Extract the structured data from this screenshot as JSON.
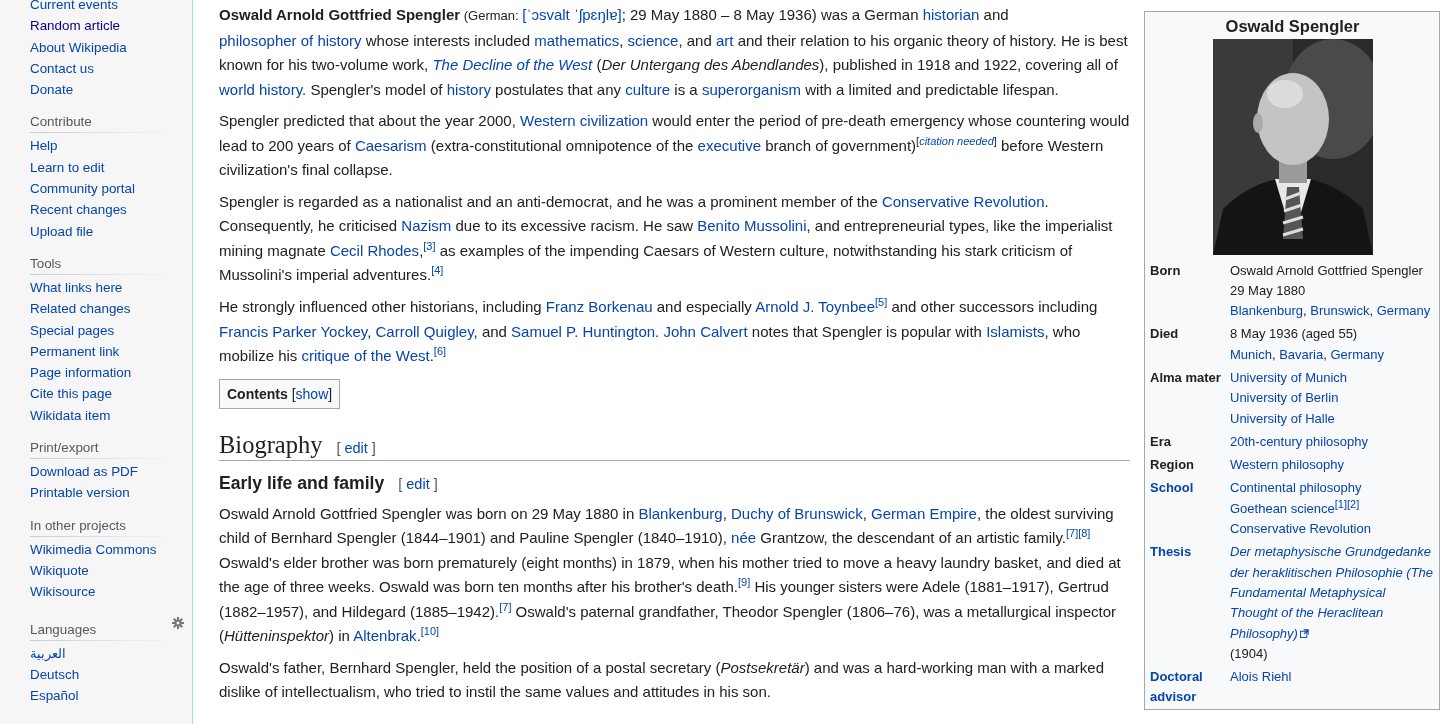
{
  "sidebar": {
    "sections": [
      {
        "kind": "navigation",
        "items": [
          {
            "label": "Current events",
            "visited": false
          },
          {
            "label": "Random article",
            "visited": true
          },
          {
            "label": "About Wikipedia",
            "visited": false
          },
          {
            "label": "Contact us",
            "visited": false
          },
          {
            "label": "Donate",
            "visited": false
          }
        ]
      },
      {
        "kind": "portal",
        "heading": "Contribute",
        "items": [
          {
            "label": "Help",
            "visited": false
          },
          {
            "label": "Learn to edit",
            "visited": false
          },
          {
            "label": "Community portal",
            "visited": false
          },
          {
            "label": "Recent changes",
            "visited": false
          },
          {
            "label": "Upload file",
            "visited": false
          }
        ]
      },
      {
        "kind": "portal",
        "heading": "Tools",
        "items": [
          {
            "label": "What links here",
            "visited": false
          },
          {
            "label": "Related changes",
            "visited": false
          },
          {
            "label": "Special pages",
            "visited": false
          },
          {
            "label": "Permanent link",
            "visited": false
          },
          {
            "label": "Page information",
            "visited": false
          },
          {
            "label": "Cite this page",
            "visited": false
          },
          {
            "label": "Wikidata item",
            "visited": false
          }
        ]
      },
      {
        "kind": "portal",
        "heading": "Print/export",
        "items": [
          {
            "label": "Download as PDF",
            "visited": false
          },
          {
            "label": "Printable version",
            "visited": false
          }
        ]
      },
      {
        "kind": "portal",
        "heading": "In other projects",
        "items": [
          {
            "label": "Wikimedia Commons",
            "visited": false
          },
          {
            "label": "Wikiquote",
            "visited": false
          },
          {
            "label": "Wikisource",
            "visited": false
          }
        ]
      },
      {
        "kind": "languages",
        "heading": "Languages",
        "items": [
          {
            "label": "العربية",
            "visited": false
          },
          {
            "label": "Deutsch",
            "visited": false
          },
          {
            "label": "Español",
            "visited": false
          }
        ]
      }
    ]
  },
  "article": {
    "blocks": [
      {
        "kind": "paragraph",
        "runs": [
          {
            "kind": "bold",
            "text": "Oswald Arnold Gottfried Spengler"
          },
          {
            "kind": "small",
            "text": " (German: "
          },
          {
            "kind": "link",
            "text": "[ˈɔsvalt ˈʃpɛŋlɐ]"
          },
          "; 29 May 1880 – 8 May 1936) was a German ",
          {
            "kind": "link",
            "text": "historian"
          },
          " and ",
          {
            "kind": "link",
            "text": "philosopher of history"
          },
          " whose interests included ",
          {
            "kind": "link",
            "text": "mathematics"
          },
          ", ",
          {
            "kind": "link",
            "text": "science"
          },
          ", and ",
          {
            "kind": "link",
            "text": "art"
          },
          " and their relation to his organic theory of history. He is best known for his two-volume work, ",
          {
            "kind": "link_italic",
            "text": "The Decline of the West"
          },
          " (",
          {
            "kind": "italic",
            "text": "Der Untergang des Abendlandes"
          },
          "), published in 1918 and 1922, covering all of ",
          {
            "kind": "link",
            "text": "world history"
          },
          ". Spengler's model of ",
          {
            "kind": "link",
            "text": "history"
          },
          " postulates that any ",
          {
            "kind": "link",
            "text": "culture"
          },
          " is a ",
          {
            "kind": "link",
            "text": "superorganism"
          },
          " with a limited and predictable lifespan."
        ]
      },
      {
        "kind": "paragraph",
        "runs": [
          "Spengler predicted that about the year 2000, ",
          {
            "kind": "link",
            "text": "Western civilization"
          },
          " would enter the period of pre-death emergency whose countering would lead to 200 years of ",
          {
            "kind": "link",
            "text": "Caesarism"
          },
          " (extra-constitutional omnipotence of the ",
          {
            "kind": "link",
            "text": "executive"
          },
          " branch of government)",
          {
            "kind": "sup",
            "text": "["
          },
          {
            "kind": "sup_link_italic",
            "text": "citation needed"
          },
          {
            "kind": "sup",
            "text": "]"
          },
          " before Western civilization's final collapse."
        ]
      },
      {
        "kind": "paragraph",
        "runs": [
          "Spengler is regarded as a nationalist and an anti-democrat, and he was a prominent member of the ",
          {
            "kind": "link",
            "text": "Conservative Revolution"
          },
          ". Consequently, he criticised ",
          {
            "kind": "link",
            "text": "Nazism"
          },
          " due to its excessive racism. He saw ",
          {
            "kind": "link",
            "text": "Benito Mussolini"
          },
          ", and entrepreneurial types, like the imperialist mining magnate ",
          {
            "kind": "link",
            "text": "Cecil Rhodes"
          },
          ",",
          {
            "kind": "ref",
            "text": "[3]"
          },
          " as examples of the impending Caesars of Western culture, notwithstanding his stark criticism of Mussolini's imperial adventures.",
          {
            "kind": "ref",
            "text": "[4]"
          }
        ]
      },
      {
        "kind": "paragraph",
        "runs": [
          "He strongly influenced other historians, including ",
          {
            "kind": "link",
            "text": "Franz Borkenau"
          },
          " and especially ",
          {
            "kind": "link",
            "text": "Arnold J. Toynbee"
          },
          {
            "kind": "ref",
            "text": "[5]"
          },
          " and other successors including ",
          {
            "kind": "link",
            "text": "Francis Parker Yockey"
          },
          ", ",
          {
            "kind": "link",
            "text": "Carroll Quigley"
          },
          ", and ",
          {
            "kind": "link",
            "text": "Samuel P. Huntington"
          },
          ". ",
          {
            "kind": "link",
            "text": "John Calvert"
          },
          " notes that Spengler is popular with ",
          {
            "kind": "link",
            "text": "Islamists"
          },
          ", who mobilize his ",
          {
            "kind": "link",
            "text": "critique of the West"
          },
          ".",
          {
            "kind": "ref",
            "text": "[6]"
          }
        ]
      },
      {
        "kind": "toc",
        "title": "Contents",
        "open_bracket": "[",
        "toggle": "show",
        "close_bracket": "]"
      },
      {
        "kind": "heading2",
        "title": "Biography",
        "open_bracket": "[",
        "edit": "edit",
        "close_bracket": "]"
      },
      {
        "kind": "heading3",
        "title": "Early life and family",
        "open_bracket": "[",
        "edit": "edit",
        "close_bracket": "]"
      },
      {
        "kind": "paragraph",
        "runs": [
          "Oswald Arnold Gottfried Spengler was born on 29 May 1880 in ",
          {
            "kind": "link",
            "text": "Blankenburg"
          },
          ", ",
          {
            "kind": "link",
            "text": "Duchy of Brunswick"
          },
          ", ",
          {
            "kind": "link",
            "text": "German Empire"
          },
          ", the oldest surviving child of Bernhard Spengler (1844–1901) and Pauline Spengler (1840–1910), ",
          {
            "kind": "link",
            "text": "née"
          },
          " Grantzow, the descendant of an artistic family.",
          {
            "kind": "ref",
            "text": "[7]"
          },
          {
            "kind": "ref",
            "text": "[8]"
          },
          " Oswald's elder brother was born prematurely (eight months) in 1879, when his mother tried to move a heavy laundry basket, and died at the age of three weeks. Oswald was born ten months after his brother's death.",
          {
            "kind": "ref",
            "text": "[9]"
          },
          " His younger sisters were Adele (1881–1917), Gertrud (1882–1957), and Hildegard (1885–1942).",
          {
            "kind": "ref",
            "text": "[7]"
          },
          " Oswald's paternal grandfather, Theodor Spengler (1806–76), was a metallurgical inspector (",
          {
            "kind": "italic",
            "text": "Hütteninspektor"
          },
          ") in ",
          {
            "kind": "link",
            "text": "Altenbrak"
          },
          ".",
          {
            "kind": "ref",
            "text": "[10]"
          }
        ]
      },
      {
        "kind": "paragraph",
        "runs": [
          "Oswald's father, Bernhard Spengler, held the position of a postal secretary (",
          {
            "kind": "italic",
            "text": "Postsekretär"
          },
          ") and was a hard-working man with a marked dislike of intellectualism, who tried to instil the same values and attitudes in his son."
        ]
      }
    ]
  },
  "infobox": {
    "title": "Oswald Spengler",
    "rows": [
      {
        "label": "Born",
        "kind": "plain_label",
        "lines": [
          [
            "Oswald Arnold Gottfried Spengler"
          ],
          [
            "29 May 1880"
          ],
          [
            {
              "kind": "link",
              "text": "Blankenburg"
            },
            ", ",
            {
              "kind": "link",
              "text": "Brunswick"
            },
            ", ",
            {
              "kind": "link",
              "text": "Germany"
            }
          ]
        ]
      },
      {
        "label": "Died",
        "kind": "plain_label",
        "lines": [
          [
            "8 May 1936 (aged 55)"
          ],
          [
            {
              "kind": "link",
              "text": "Munich"
            },
            ", ",
            {
              "kind": "link",
              "text": "Bavaria"
            },
            ", ",
            {
              "kind": "link",
              "text": "Germany"
            }
          ]
        ]
      },
      {
        "label": "Alma mater",
        "kind": "plain_label",
        "lines": [
          [
            {
              "kind": "link",
              "text": "University of Munich"
            }
          ],
          [
            {
              "kind": "link",
              "text": "University of Berlin"
            }
          ],
          [
            {
              "kind": "link",
              "text": "University of Halle"
            }
          ]
        ]
      },
      {
        "label": "Era",
        "kind": "plain_label",
        "lines": [
          [
            {
              "kind": "link",
              "text": "20th-century philosophy"
            }
          ]
        ]
      },
      {
        "label": "Region",
        "kind": "plain_label",
        "lines": [
          [
            {
              "kind": "link",
              "text": "Western philosophy"
            }
          ]
        ]
      },
      {
        "label": "School",
        "kind": "link_label",
        "lines": [
          [
            {
              "kind": "link",
              "text": "Continental philosophy"
            }
          ],
          [
            {
              "kind": "link",
              "text": "Goethean science"
            },
            {
              "kind": "ref",
              "text": "[1]"
            },
            {
              "kind": "ref",
              "text": "[2]"
            }
          ],
          [
            {
              "kind": "link",
              "text": "Conservative Revolution"
            }
          ]
        ]
      },
      {
        "label": "Thesis",
        "kind": "link_label",
        "lines": [
          [
            {
              "kind": "external_link_italic",
              "text": "Der metaphysische Grundgedanke der heraklitischen Philosophie (The Fundamental Metaphysical Thought of the Heraclitean Philosophy)"
            },
            " (1904)"
          ]
        ]
      },
      {
        "label": "Doctoral advisor",
        "kind": "link_label",
        "lines": [
          [
            {
              "kind": "link",
              "text": "Alois Riehl"
            }
          ]
        ]
      }
    ]
  }
}
